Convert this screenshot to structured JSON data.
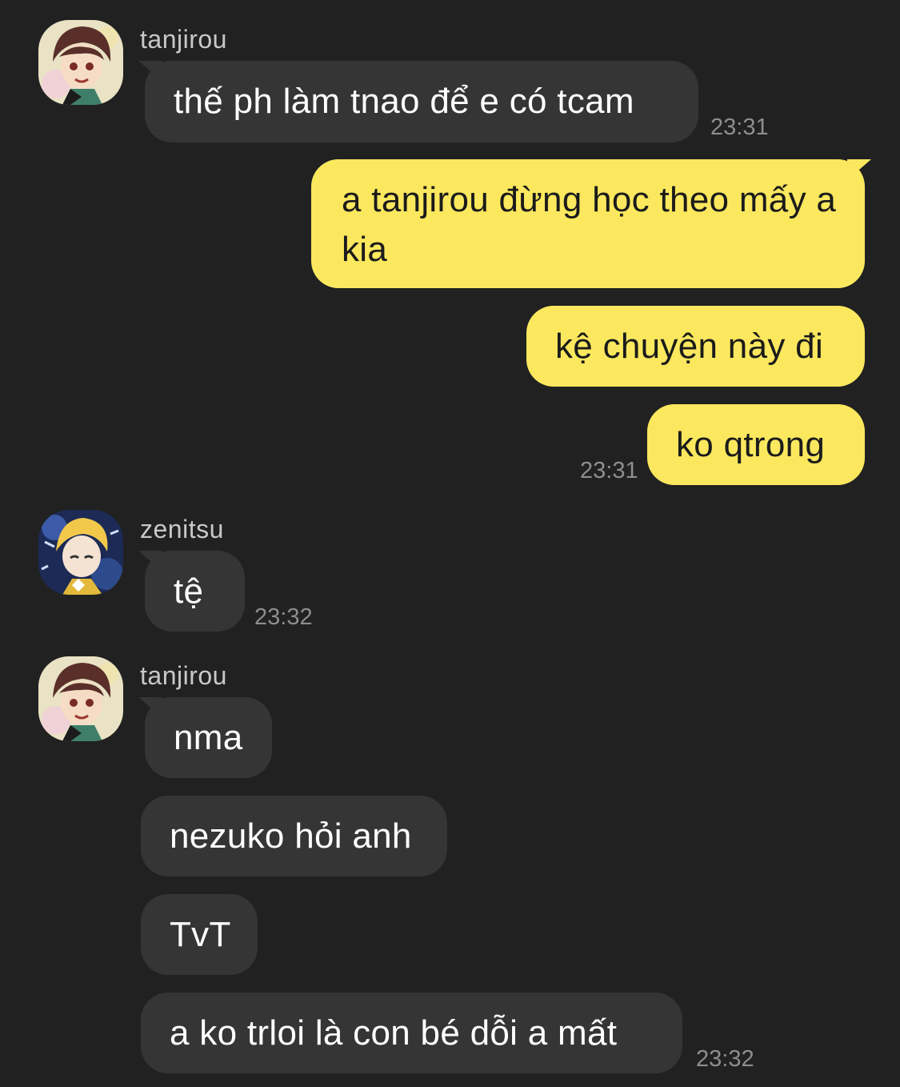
{
  "messages": [
    {
      "sender": "tanjirou",
      "text": "thế ph làm tnao để e có tcam",
      "time": "23:31"
    },
    {
      "text": "a tanjirou đừng học theo mấy a kia"
    },
    {
      "text": "kệ chuyện này đi"
    },
    {
      "text": "ko qtrong",
      "time": "23:31"
    },
    {
      "sender": "zenitsu",
      "text": "tệ",
      "time": "23:32"
    },
    {
      "sender": "tanjirou",
      "text": "nma"
    },
    {
      "text": "nezuko hỏi anh"
    },
    {
      "text": "TvT"
    },
    {
      "text": "a ko trloi là con bé dỗi a mất",
      "time": "23:32"
    }
  ],
  "avatars": [
    {
      "name": "tanjirou-avatar-icon"
    },
    {
      "name": "zenitsu-avatar-icon"
    },
    {
      "name": "tanjirou-avatar-icon"
    }
  ],
  "colors": {
    "background": "#212121",
    "incoming_bubble": "#353535",
    "outgoing_bubble": "#fbe85e",
    "timestamp": "#8e8e8e"
  }
}
